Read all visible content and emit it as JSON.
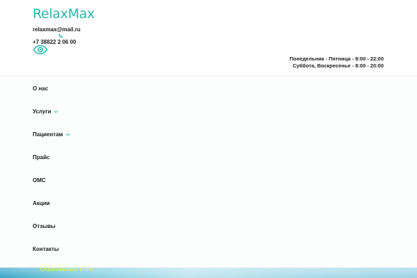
{
  "brand": {
    "logo_text": "RelaxMax",
    "accent_color": "#2bb5ab"
  },
  "contacts": {
    "email": "relaxmax@mail.ru",
    "phone": "+7 38822 2 06 00",
    "phone_icon": "phone-icon",
    "accessibility_icon": "eye-icon"
  },
  "hours": {
    "weekdays": "Понедельник - Пятница - 8:00 - 22:00",
    "weekend": "Суббота, Воскресенье - 8:00 - 20:00"
  },
  "menu": {
    "items": [
      {
        "label": "О нас",
        "has_submenu": false
      },
      {
        "label": "Услуги",
        "has_submenu": true
      },
      {
        "label": "Пациентам",
        "has_submenu": true
      },
      {
        "label": "Прайс",
        "has_submenu": false
      },
      {
        "label": "ОМС",
        "has_submenu": false
      },
      {
        "label": "Акции",
        "has_submenu": false
      },
      {
        "label": "Отзывы",
        "has_submenu": false
      },
      {
        "label": "Контакты",
        "has_submenu": false
      }
    ]
  },
  "banner": {
    "caption": "СПОРТИВНЫЙ КЛУБ"
  }
}
